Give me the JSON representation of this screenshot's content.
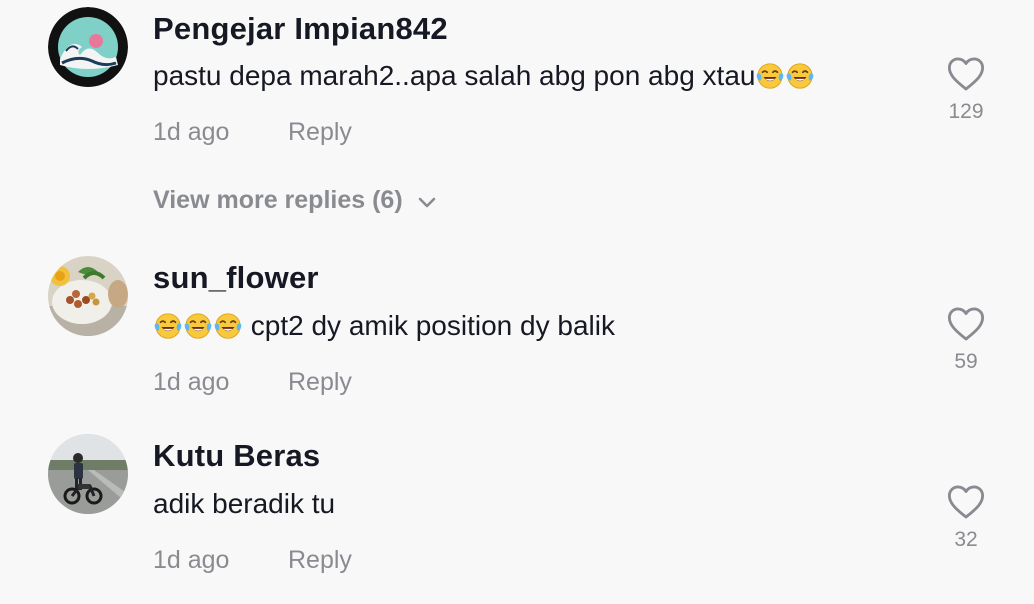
{
  "comments": [
    {
      "username": "Pengejar Impian842",
      "text_before": "pastu depa marah2..apa salah abg pon abg xtau",
      "text_after": "",
      "emoji_count_before": 0,
      "emoji_count_after": 2,
      "emoji_icon": "face-with-tears-of-joy-icon",
      "time": "1d ago",
      "reply_label": "Reply",
      "likes": "129",
      "avatar_icon": "great-wave-artwork-avatar"
    },
    {
      "username": "sun_flower",
      "text_before": "",
      "text_after": " cpt2 dy amik position dy balik",
      "emoji_count_before": 3,
      "emoji_count_after": 0,
      "emoji_icon": "face-with-tears-of-joy-icon",
      "time": "1d ago",
      "reply_label": "Reply",
      "likes": "59",
      "avatar_icon": "food-plate-photo-avatar"
    },
    {
      "username": "Kutu Beras",
      "text_before": "adik beradik tu",
      "text_after": "",
      "emoji_count_before": 0,
      "emoji_count_after": 0,
      "emoji_icon": "",
      "time": "1d ago",
      "reply_label": "Reply",
      "likes": "32",
      "avatar_icon": "motorcycle-rider-photo-avatar"
    }
  ],
  "view_more": {
    "label": "View more replies (6)",
    "icon": "chevron-down-icon"
  },
  "colors": {
    "background": "#f8f8f8",
    "primary_text": "#161823",
    "secondary_text": "#8a8b91"
  }
}
